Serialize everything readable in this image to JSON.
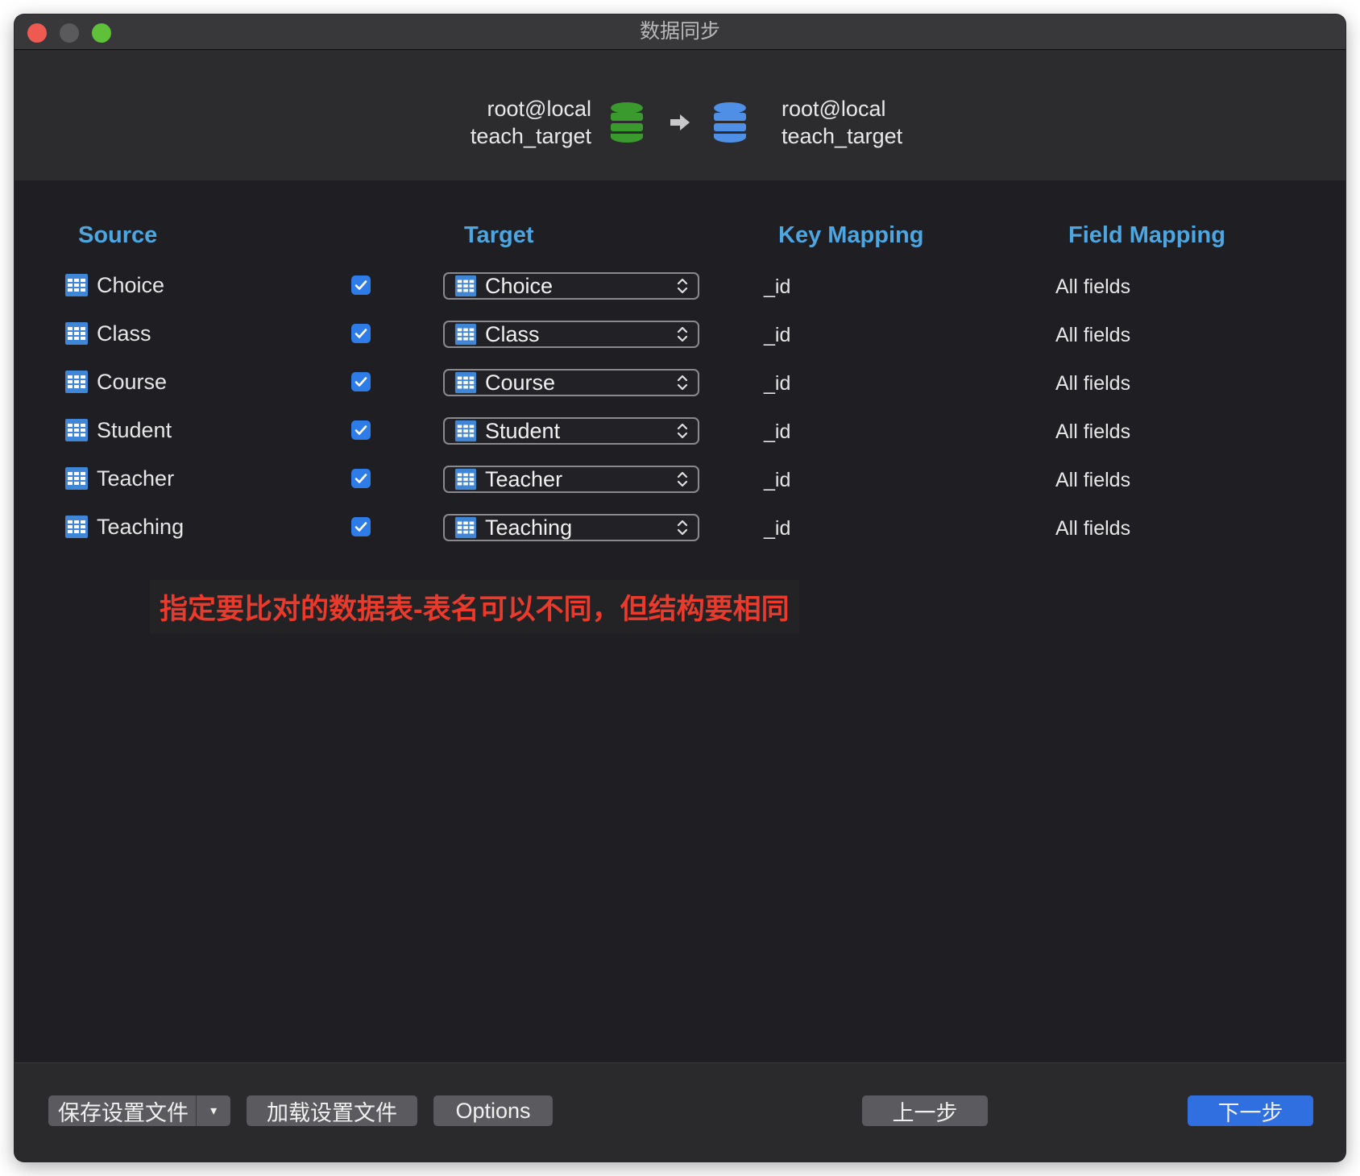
{
  "window": {
    "title": "数据同步",
    "accent_color": "#4ea6e0",
    "next_button_color": "#2f6fe0",
    "note_color": "#ea3a2c"
  },
  "connection": {
    "source": {
      "line1": "root@local",
      "line2": "teach_target",
      "icon": "database-icon-green",
      "color": "#3a9a2e"
    },
    "arrow_icon": "arrow-right-icon",
    "target": {
      "line1": "root@local",
      "line2": "teach_target",
      "icon": "database-icon-blue",
      "color": "#4f8fe6"
    }
  },
  "headers": {
    "source": "Source",
    "target": "Target",
    "key_mapping": "Key Mapping",
    "field_mapping": "Field Mapping"
  },
  "rows": [
    {
      "source": "Choice",
      "checked": true,
      "target": "Choice",
      "key": "_id",
      "field": "All fields"
    },
    {
      "source": "Class",
      "checked": true,
      "target": "Class",
      "key": "_id",
      "field": "All fields"
    },
    {
      "source": "Course",
      "checked": true,
      "target": "Course",
      "key": "_id",
      "field": "All fields"
    },
    {
      "source": "Student",
      "checked": true,
      "target": "Student",
      "key": "_id",
      "field": "All fields"
    },
    {
      "source": "Teacher",
      "checked": true,
      "target": "Teacher",
      "key": "_id",
      "field": "All fields"
    },
    {
      "source": "Teaching",
      "checked": true,
      "target": "Teaching",
      "key": "_id",
      "field": "All fields"
    }
  ],
  "note": "指定要比对的数据表-表名可以不同，但结构要相同",
  "footer": {
    "save_label": "保存设置文件",
    "save_caret": "▾",
    "load_label": "加载设置文件",
    "options_label": "Options",
    "prev_label": "上一步",
    "next_label": "下一步"
  }
}
